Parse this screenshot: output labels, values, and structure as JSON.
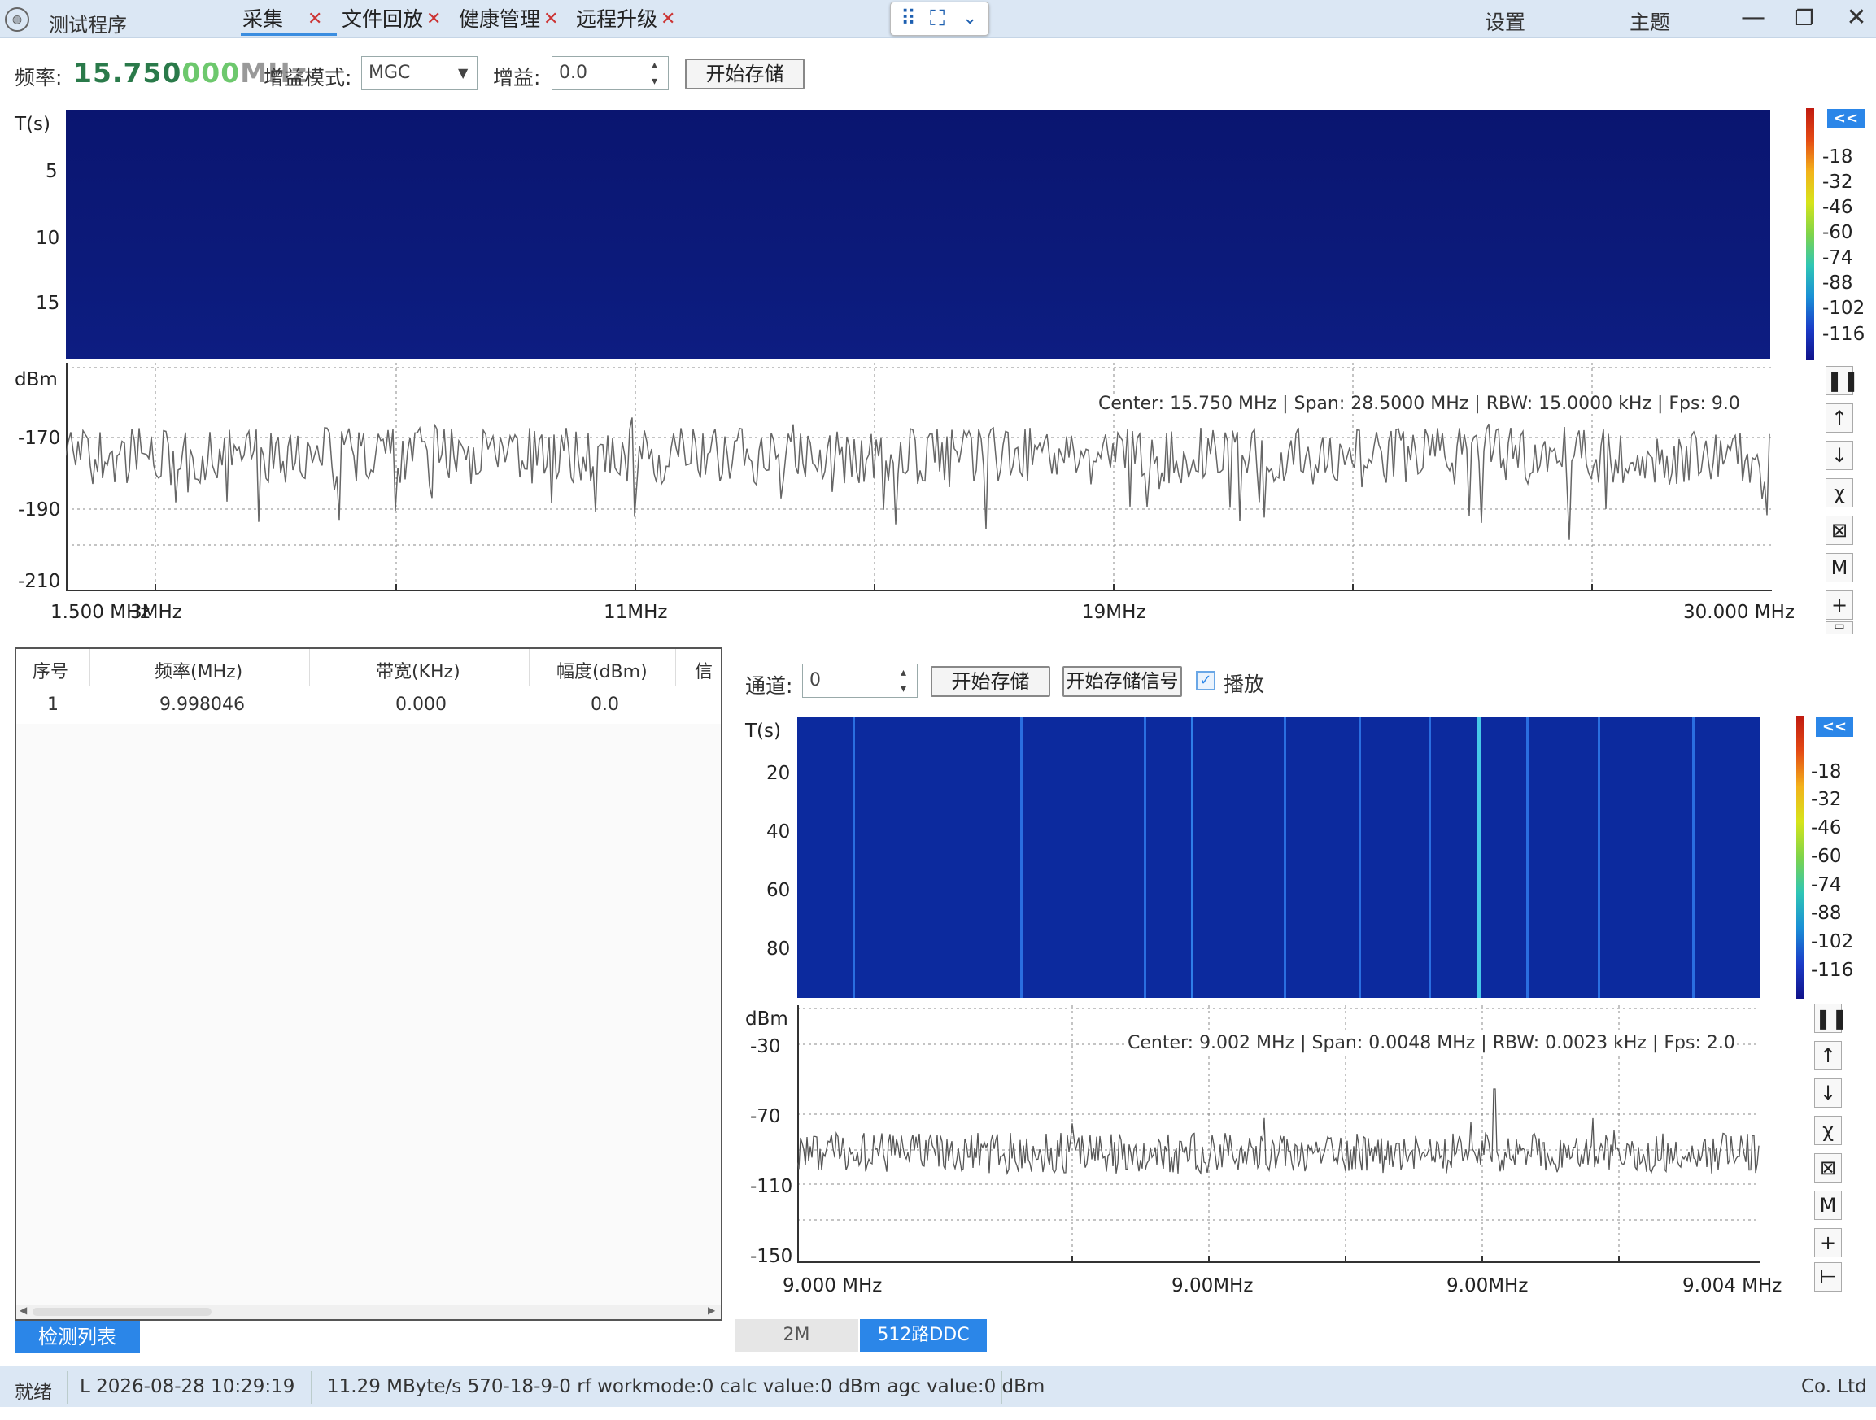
{
  "app": {
    "title": "测试程序",
    "icon": "waveform-logo-icon"
  },
  "tabs": [
    {
      "label": "采集",
      "active": true
    },
    {
      "label": "文件回放"
    },
    {
      "label": "健康管理"
    },
    {
      "label": "远程升级"
    }
  ],
  "titlebar": {
    "settings": "设置",
    "theme": "主题"
  },
  "toolbar": {
    "freq_label": "频率:",
    "freq_main": "15.750",
    "freq_zeros": "000",
    "freq_unit": "MHz",
    "gain_mode_label": "增益模式:",
    "gain_mode_value": "MGC",
    "gain_label": "增益:",
    "gain_value": "0.0",
    "start_store": "开始存储"
  },
  "colorbar": {
    "labels": [
      "-18",
      "-32",
      "-46",
      "-60",
      "-74",
      "-88",
      "-102",
      "-116"
    ],
    "collapse": "<<"
  },
  "top": {
    "wf_ylabel": "T(s)",
    "wf_yticks": [
      "5",
      "10",
      "15"
    ],
    "spec_ylabel": "dBm",
    "spec_yticks": [
      "-170",
      "-190",
      "-210"
    ],
    "info": "Center: 15.750 MHz | Span: 28.5000 MHz | RBW: 15.0000 kHz | Fps: 9.0",
    "xticks": [
      "1.500 MHz",
      "3MHz",
      "11MHz",
      "19MHz",
      "30.000 MHz"
    ]
  },
  "list": {
    "headers": [
      "序号",
      "频率(MHz)",
      "带宽(KHz)",
      "幅度(dBm)",
      "信噪"
    ],
    "rows": [
      [
        "1",
        "9.998046",
        "0.000",
        "0.0"
      ]
    ],
    "tab": "检测列表"
  },
  "ddc": {
    "channel_label": "通道:",
    "channel_value": "0",
    "start_store": "开始存储",
    "start_store_signal": "开始存储信号",
    "play_label": "播放",
    "play_checked": true,
    "wf_ylabel": "T(s)",
    "wf_yticks": [
      "20",
      "40",
      "60",
      "80"
    ],
    "spec_ylabel": "dBm",
    "spec_yticks": [
      "-30",
      "-70",
      "-110",
      "-150"
    ],
    "info": "Center: 9.002 MHz | Span: 0.0048 MHz | RBW: 0.0023 kHz | Fps: 2.0",
    "xticks": [
      "9.000 MHz",
      "9.00MHz",
      "9.00MHz",
      "9.004 MHz"
    ]
  },
  "bottom_tabs": [
    {
      "label": "2M"
    },
    {
      "label": "512路DDC",
      "active": true
    }
  ],
  "status": {
    "state": "就绪",
    "time": "L 2026-08-28 10:29:19",
    "info": "11.29 MByte/s 570-18-9-0 rf workmode:0 calc value:0 dBm agc value:0 dBm",
    "company": "Co. Ltd"
  },
  "controls": [
    "pause-icon",
    "arrow-up-icon",
    "arrow-down-icon",
    "chi-icon",
    "fit-icon",
    "marker-icon",
    "plus-icon",
    "ruler-icon"
  ]
}
